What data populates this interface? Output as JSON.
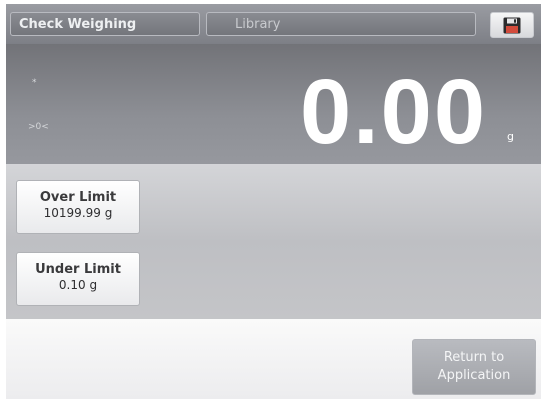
{
  "header": {
    "app_tab": "Check Weighing",
    "library_tab": "Library",
    "save_icon": "floppy-disk-icon"
  },
  "display": {
    "star": "*",
    "zero_indicator": ">0<",
    "weight": "0.00",
    "unit": "g"
  },
  "limits": {
    "over": {
      "label": "Over Limit",
      "value": "10199.99 g"
    },
    "under": {
      "label": "Under Limit",
      "value": "0.10 g"
    }
  },
  "footer": {
    "return_line1": "Return to",
    "return_line2": "Application"
  },
  "colors": {
    "display_bg": "#7e8086",
    "weight_text": "#ffffff",
    "button_bg": "#ffffff"
  }
}
